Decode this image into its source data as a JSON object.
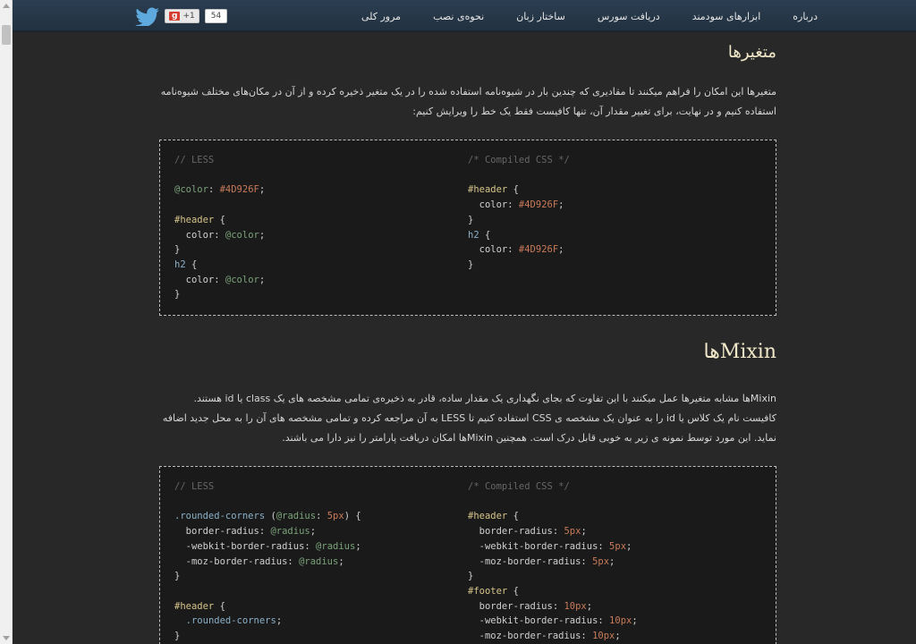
{
  "nav": {
    "items": [
      "مرور کلی",
      "نحوه‌ی نصب",
      "ساختار زبان",
      "دریافت سورس",
      "ابزارهای سودمند",
      "درباره"
    ],
    "gplus_label": "+1",
    "share_count": "54"
  },
  "variables": {
    "title": "متغیرها",
    "paragraph": "متغیرها این امکان را فراهم میکنند تا مقادیری که چندین بار در شیوه‌نامه استفاده شده را در یک متغیر ذخیره کرده و از آن در مکان‌های مختلف شیوه‌نامه استفاده کنیم و در نهایت، برای تغییر مقدار آن، تنها کافیست فقط یک خط را ویرایش کنیم:",
    "less_comment": "// LESS",
    "css_comment": "/* Compiled CSS */"
  },
  "mixins": {
    "title": "Mixinها",
    "paragraph": "Mixinها مشابه متغیرها عمل میکنند با این تفاوت که بجای نگهداری یک مقدار ساده، قادر به ذخیره‌ی تمامی مشخصه های یک class یا id هستند. کافیست نام یک کلاس یا id را به عنوان یک مشخصه ی CSS استفاده کنیم تا LESS به آن مراجعه کرده و تمامی مشخصه های آن را به محل جدید اضافه نماید. این مورد توسط نمونه ی زیر به خوبی قابل درک است. همچنین Mixinها امکان دریافت پارامتر را نیز دارا می باشند.",
    "less_comment": "// LESS",
    "css_comment": "/* Compiled CSS */"
  },
  "colors": {
    "background": "#282828",
    "navbar": "#22313f",
    "heading": "#f0e8c8",
    "code_bg": "#1a1a1a"
  }
}
